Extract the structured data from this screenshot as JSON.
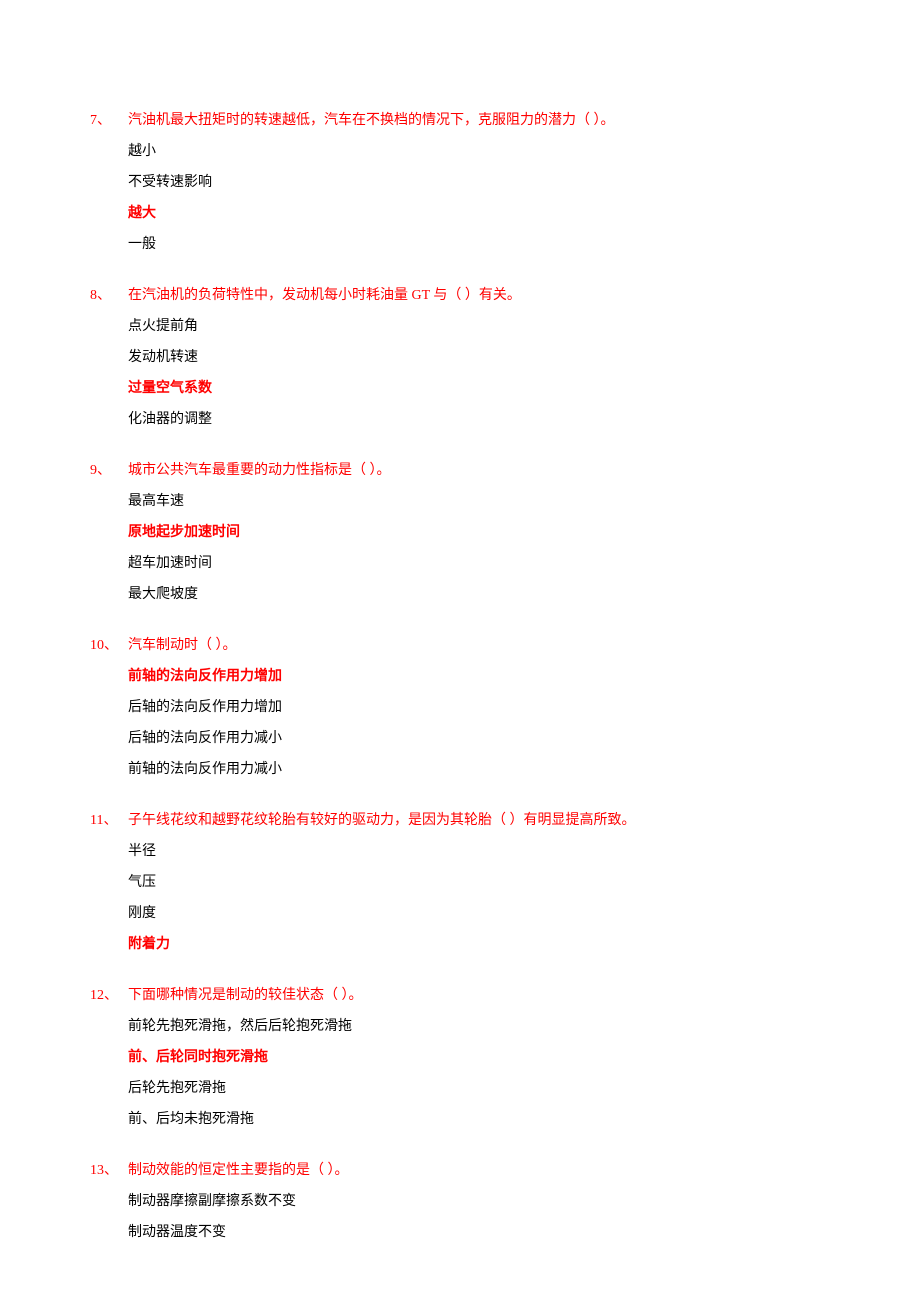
{
  "questions": [
    {
      "number": "7、",
      "text": "汽油机最大扭矩时的转速越低，汽车在不换档的情况下，克服阻力的潜力（  ）。",
      "options": [
        {
          "text": "越小",
          "correct": false
        },
        {
          "text": "不受转速影响",
          "correct": false
        },
        {
          "text": "越大",
          "correct": true
        },
        {
          "text": "一般",
          "correct": false
        }
      ]
    },
    {
      "number": "8、",
      "text": "在汽油机的负荷特性中，发动机每小时耗油量 GT 与（  ）有关。",
      "options": [
        {
          "text": "点火提前角",
          "correct": false
        },
        {
          "text": "发动机转速",
          "correct": false
        },
        {
          "text": "过量空气系数",
          "correct": true
        },
        {
          "text": "化油器的调整",
          "correct": false
        }
      ]
    },
    {
      "number": "9、",
      "text": "城市公共汽车最重要的动力性指标是（  ）。",
      "options": [
        {
          "text": "最高车速",
          "correct": false
        },
        {
          "text": "原地起步加速时间",
          "correct": true
        },
        {
          "text": "超车加速时间",
          "correct": false
        },
        {
          "text": "最大爬坡度",
          "correct": false
        }
      ]
    },
    {
      "number": "10、",
      "text": "汽车制动时（  ）。",
      "options": [
        {
          "text": "前轴的法向反作用力增加",
          "correct": true
        },
        {
          "text": "后轴的法向反作用力增加",
          "correct": false
        },
        {
          "text": "后轴的法向反作用力减小",
          "correct": false
        },
        {
          "text": "前轴的法向反作用力减小",
          "correct": false
        }
      ]
    },
    {
      "number": "11、",
      "text": "子午线花纹和越野花纹轮胎有较好的驱动力，是因为其轮胎（  ）有明显提高所致。",
      "options": [
        {
          "text": "半径",
          "correct": false
        },
        {
          "text": "气压",
          "correct": false
        },
        {
          "text": "刚度",
          "correct": false
        },
        {
          "text": "附着力",
          "correct": true
        }
      ]
    },
    {
      "number": "12、",
      "text": "下面哪种情况是制动的较佳状态（  ）。",
      "options": [
        {
          "text": "前轮先抱死滑拖，然后后轮抱死滑拖",
          "correct": false
        },
        {
          "text": "前、后轮同时抱死滑拖",
          "correct": true
        },
        {
          "text": "后轮先抱死滑拖",
          "correct": false
        },
        {
          "text": "前、后均未抱死滑拖",
          "correct": false
        }
      ]
    },
    {
      "number": "13、",
      "text": "制动效能的恒定性主要指的是（  ）。",
      "options": [
        {
          "text": "制动器摩擦副摩擦系数不变",
          "correct": false
        },
        {
          "text": "制动器温度不变",
          "correct": false
        }
      ]
    }
  ]
}
